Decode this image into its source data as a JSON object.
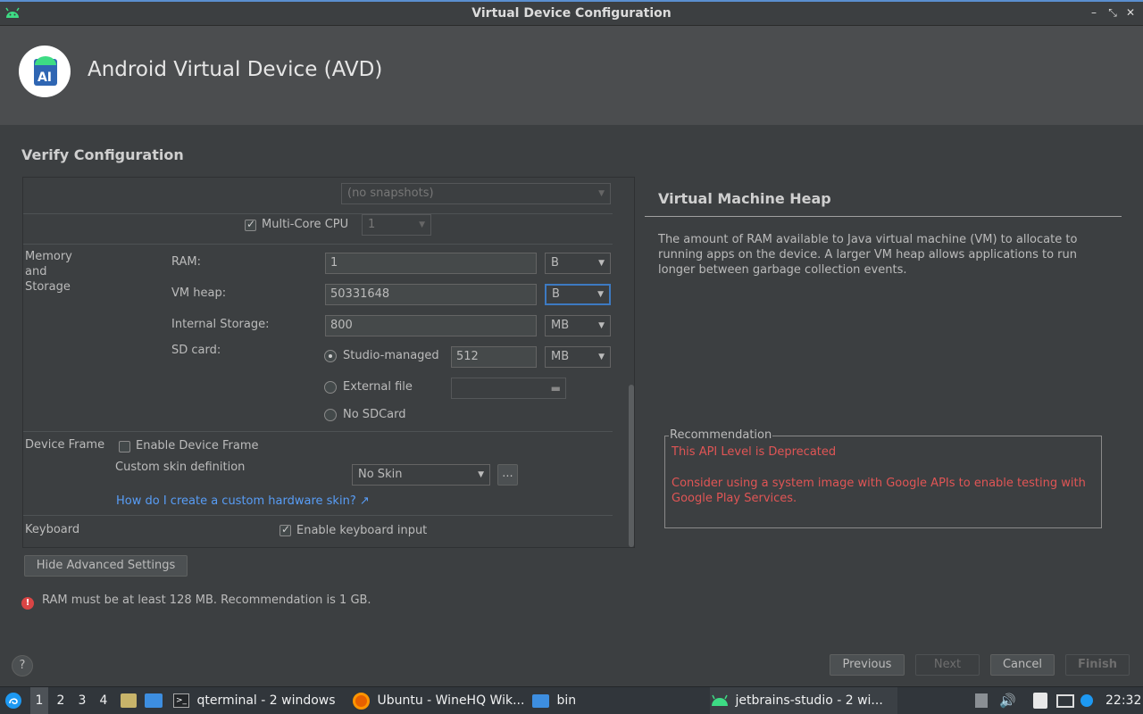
{
  "window": {
    "title": "Virtual Device Configuration",
    "minimize_glyph": "–",
    "maximize_glyph": "⤡",
    "close_glyph": "✕",
    "app_icon": "android-icon"
  },
  "header": {
    "title": "Android Virtual Device (AVD)",
    "logo": "android-studio-logo"
  },
  "section_title": "Verify Configuration",
  "form": {
    "snapshot_combo": "(no snapshots)",
    "multicore_label": "Multi-Core CPU",
    "multicore_checked": true,
    "multicore_value": "1",
    "memory_group_label_1": "Memory",
    "memory_group_label_2": "and",
    "memory_group_label_3": "Storage",
    "ram_label": "RAM:",
    "ram_value": "1",
    "ram_unit": "B",
    "vmheap_label": "VM heap:",
    "vmheap_value": "50331648",
    "vmheap_unit": "B",
    "internal_label": "Internal Storage:",
    "internal_value": "800",
    "internal_unit": "MB",
    "sdcard_label": "SD card:",
    "sd_studio_label": "Studio-managed",
    "sd_studio_value": "512",
    "sd_studio_unit": "MB",
    "sd_external_label": "External file",
    "sd_none_label": "No SDCard",
    "device_frame_group": "Device Frame",
    "enable_frame_label": "Enable Device Frame",
    "custom_skin_label": "Custom skin definition",
    "skin_value": "No Skin",
    "skin_browse": "...",
    "skin_help_link": "How do I create a custom hardware skin? ↗",
    "keyboard_group": "Keyboard",
    "keyboard_label": "Enable keyboard input",
    "keyboard_checked": true
  },
  "hide_advanced": "Hide Advanced Settings",
  "error_message": "RAM must be at least 128 MB. Recommendation is 1 GB.",
  "right_panel": {
    "title": "Virtual Machine Heap",
    "description": "The amount of RAM available to Java virtual machine (VM) to allocate to running apps on the device. A larger VM heap allows applications to run longer between garbage collection events.",
    "recommendation_title": "Recommendation",
    "recommendation_line1": "This API Level is Deprecated",
    "recommendation_line2": "Consider using a system image with Google APIs to enable testing with Google Play Services."
  },
  "footer": {
    "help": "?",
    "previous": "Previous",
    "next": "Next",
    "cancel": "Cancel",
    "finish": "Finish"
  },
  "taskbar": {
    "desktops": [
      "1",
      "2",
      "3",
      "4"
    ],
    "tasks": [
      {
        "label": "qterminal - 2 windows",
        "icon": "terminal-icon"
      },
      {
        "label": "Ubuntu - WineHQ Wik...",
        "icon": "firefox-icon"
      },
      {
        "label": "bin",
        "icon": "folder-icon"
      },
      {
        "label": "jetbrains-studio - 2 wi...",
        "icon": "android-icon"
      }
    ],
    "clock": "22:32"
  },
  "colors": {
    "background": "#3c3f41",
    "header": "#4b4d4f",
    "accent": "#3d7ac2",
    "error": "#e05555",
    "link": "#589df6"
  }
}
